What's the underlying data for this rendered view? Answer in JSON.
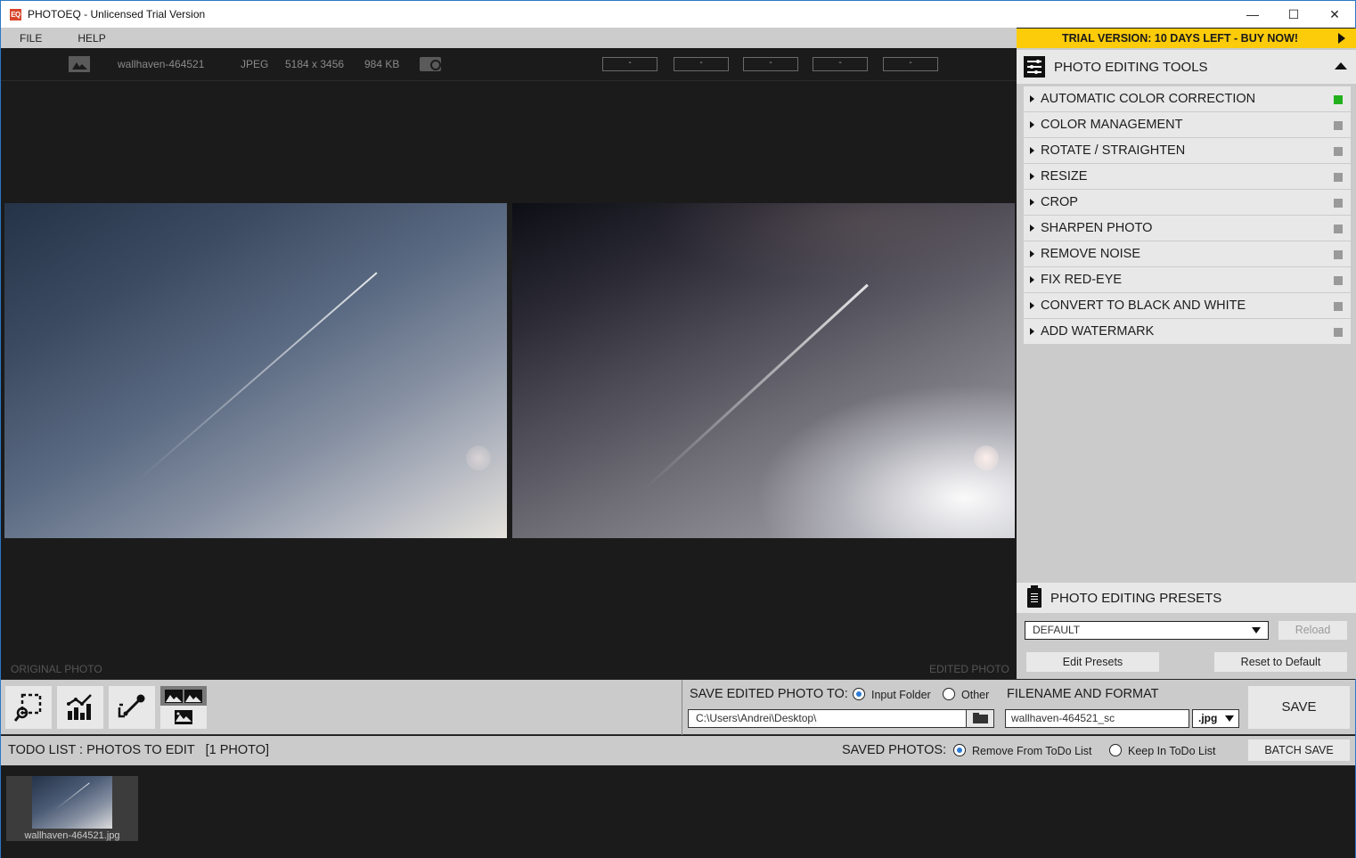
{
  "window": {
    "title": "PHOTOEQ -  Unlicensed Trial Version",
    "logo_text": "EQ",
    "minimize": "—",
    "maximize": "☐",
    "close": "✕"
  },
  "menu": {
    "file": "FILE",
    "help": "HELP"
  },
  "trial_banner": {
    "text": "TRIAL VERSION: 10 DAYS LEFT - BUY NOW!",
    "color": "#fccb0a"
  },
  "info": {
    "filename": "wallhaven-464521",
    "format": "JPEG",
    "dimensions": "5184 x 3456",
    "size": "984 KB",
    "readouts": [
      "-",
      "-",
      "-",
      "-",
      "-"
    ]
  },
  "viewer": {
    "original_label": "ORIGINAL PHOTO",
    "edited_label": "EDITED PHOTO"
  },
  "tools_panel": {
    "title": "PHOTO EDITING TOOLS",
    "items": [
      {
        "label": "AUTOMATIC COLOR CORRECTION",
        "active": true
      },
      {
        "label": "COLOR MANAGEMENT",
        "active": false
      },
      {
        "label": "ROTATE / STRAIGHTEN",
        "active": false
      },
      {
        "label": "RESIZE",
        "active": false
      },
      {
        "label": "CROP",
        "active": false
      },
      {
        "label": "SHARPEN PHOTO",
        "active": false
      },
      {
        "label": "REMOVE NOISE",
        "active": false
      },
      {
        "label": "FIX RED-EYE",
        "active": false
      },
      {
        "label": "CONVERT TO BLACK AND WHITE",
        "active": false
      },
      {
        "label": "ADD WATERMARK",
        "active": false
      }
    ],
    "active_color": "#22b11c",
    "inactive_color": "#9a9a9a"
  },
  "presets_panel": {
    "title": "PHOTO EDITING PRESETS",
    "selected": "DEFAULT",
    "reload": "Reload",
    "edit": "Edit Presets",
    "reset": "Reset to Default"
  },
  "view_tools": [
    {
      "name": "zoom-selection"
    },
    {
      "name": "histogram"
    },
    {
      "name": "color-picker"
    },
    {
      "name": "compare-view"
    }
  ],
  "save": {
    "label": "SAVE EDITED PHOTO TO:",
    "option_input": "Input Folder",
    "option_other": "Other",
    "selected": "Input Folder",
    "folder_path": "C:\\Users\\Andrei\\Desktop\\",
    "filename_label": "FILENAME AND FORMAT",
    "filename": "wallhaven-464521_sc",
    "format": ".jpg",
    "save_button": "SAVE"
  },
  "todo": {
    "title": "TODO LIST : PHOTOS TO EDIT   [1 PHOTO]",
    "saved_photos_label": "SAVED PHOTOS:",
    "option_remove": "Remove From ToDo List",
    "option_keep": "Keep In ToDo List",
    "selected": "Remove From ToDo List",
    "batch_save": "BATCH SAVE",
    "thumbnails": [
      {
        "label": "wallhaven-464521.jpg"
      }
    ]
  }
}
